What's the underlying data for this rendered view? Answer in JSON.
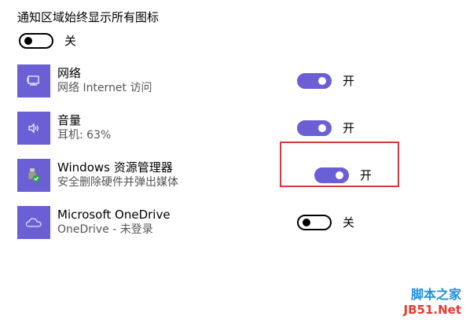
{
  "global": {
    "label": "通知区域始终显示所有图标",
    "toggle_state": "关"
  },
  "apps": [
    {
      "name": "网络",
      "subtitle": "网络 Internet 访问",
      "state": "开",
      "icon": "network-icon"
    },
    {
      "name": "音量",
      "subtitle": "耳机: 63%",
      "state": "开",
      "icon": "volume-icon"
    },
    {
      "name": "Windows 资源管理器",
      "subtitle": "安全删除硬件并弹出媒体",
      "state": "开",
      "icon": "usb-safe-remove-icon"
    },
    {
      "name": "Microsoft OneDrive",
      "subtitle": "OneDrive - 未登录",
      "state": "关",
      "icon": "onedrive-cloud-icon"
    }
  ],
  "watermark": {
    "line1": "脚本之家",
    "line2": "JB51.Net"
  },
  "colors": {
    "accent": "#6b5fd6",
    "highlight": "#d9363e"
  }
}
